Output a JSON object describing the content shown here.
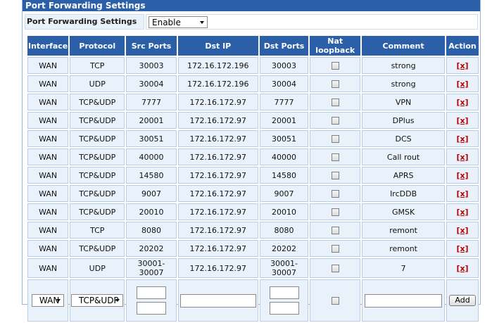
{
  "title": "Port Forwarding Settings",
  "setting": {
    "label": "Port Forwarding Settings",
    "value": "Enable"
  },
  "columns": [
    "Interface",
    "Protocol",
    "Src Ports",
    "Dst IP",
    "Dst Ports",
    "Nat loopback",
    "Comment",
    "Action"
  ],
  "rows": [
    {
      "iface": "WAN",
      "proto": "TCP",
      "src": "30003",
      "dstip": "172.16.172.196",
      "dst": "30003",
      "comment": "strong",
      "action": "[x]"
    },
    {
      "iface": "WAN",
      "proto": "UDP",
      "src": "30004",
      "dstip": "172.16.172.196",
      "dst": "30004",
      "comment": "strong",
      "action": "[x]"
    },
    {
      "iface": "WAN",
      "proto": "TCP&UDP",
      "src": "7777",
      "dstip": "172.16.172.97",
      "dst": "7777",
      "comment": "VPN",
      "action": "[x]"
    },
    {
      "iface": "WAN",
      "proto": "TCP&UDP",
      "src": "20001",
      "dstip": "172.16.172.97",
      "dst": "20001",
      "comment": "DPlus",
      "action": "[x]"
    },
    {
      "iface": "WAN",
      "proto": "TCP&UDP",
      "src": "30051",
      "dstip": "172.16.172.97",
      "dst": "30051",
      "comment": "DCS",
      "action": "[x]"
    },
    {
      "iface": "WAN",
      "proto": "TCP&UDP",
      "src": "40000",
      "dstip": "172.16.172.97",
      "dst": "40000",
      "comment": "Call rout",
      "action": "[x]"
    },
    {
      "iface": "WAN",
      "proto": "TCP&UDP",
      "src": "14580",
      "dstip": "172.16.172.97",
      "dst": "14580",
      "comment": "APRS",
      "action": "[x]"
    },
    {
      "iface": "WAN",
      "proto": "TCP&UDP",
      "src": "9007",
      "dstip": "172.16.172.97",
      "dst": "9007",
      "comment": "IrcDDB",
      "action": "[x]"
    },
    {
      "iface": "WAN",
      "proto": "TCP&UDP",
      "src": "20010",
      "dstip": "172.16.172.97",
      "dst": "20010",
      "comment": "GMSK",
      "action": "[x]"
    },
    {
      "iface": "WAN",
      "proto": "TCP",
      "src": "8080",
      "dstip": "172.16.172.97",
      "dst": "8080",
      "comment": "remont",
      "action": "[x]"
    },
    {
      "iface": "WAN",
      "proto": "TCP&UDP",
      "src": "20202",
      "dstip": "172.16.172.97",
      "dst": "20202",
      "comment": "remont",
      "action": "[x]"
    },
    {
      "iface": "WAN",
      "proto": "UDP",
      "src": "30001-30007",
      "dstip": "172.16.172.97",
      "dst": "30001-30007",
      "comment": "7",
      "action": "[x]"
    }
  ],
  "new_row": {
    "iface": "WAN",
    "proto": "TCP&UDP",
    "add_label": "Add"
  },
  "colors": {
    "header": "#2b5fa8",
    "cell": "#e9f2fb",
    "delete": "#c00000"
  }
}
